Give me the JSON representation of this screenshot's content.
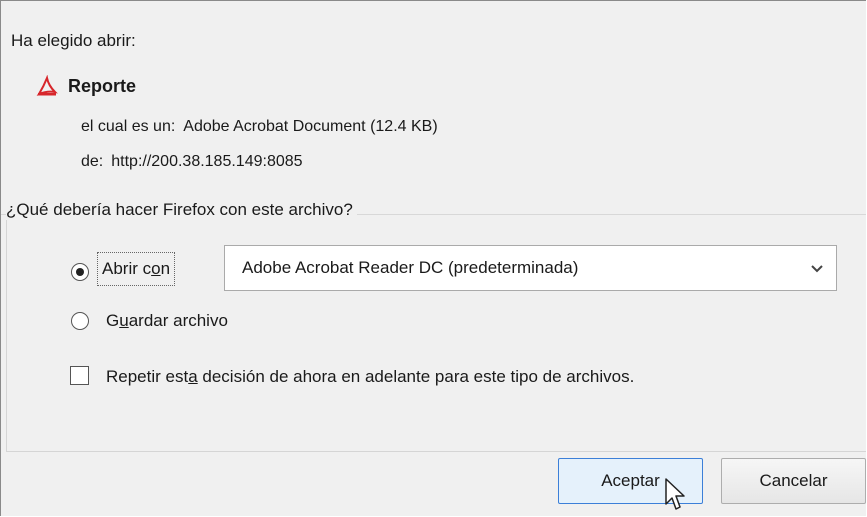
{
  "dialog": {
    "intro": "Ha elegido abrir:",
    "file": {
      "icon": "pdf-icon",
      "name": "Reporte",
      "type_label": "el cual es un:",
      "type_value": "Adobe Acrobat Document (12.4 KB)",
      "from_label": "de:",
      "from_value": "http://200.38.185.149:8085"
    },
    "question": "¿Qué debería hacer Firefox con este archivo?",
    "open_with": {
      "label_prefix": "Abrir c",
      "label_access": "o",
      "label_suffix": "n",
      "selected": true,
      "app": "Adobe Acrobat Reader DC  (predeterminada)"
    },
    "save_file": {
      "label_prefix": "G",
      "label_access": "u",
      "label_suffix": "ardar archivo",
      "selected": false
    },
    "repeat": {
      "label_prefix": "Repetir est",
      "label_access": "a",
      "label_suffix": " decisión de ahora en adelante para este tipo de archivos.",
      "checked": false
    },
    "buttons": {
      "accept": "Aceptar",
      "cancel": "Cancelar"
    }
  }
}
